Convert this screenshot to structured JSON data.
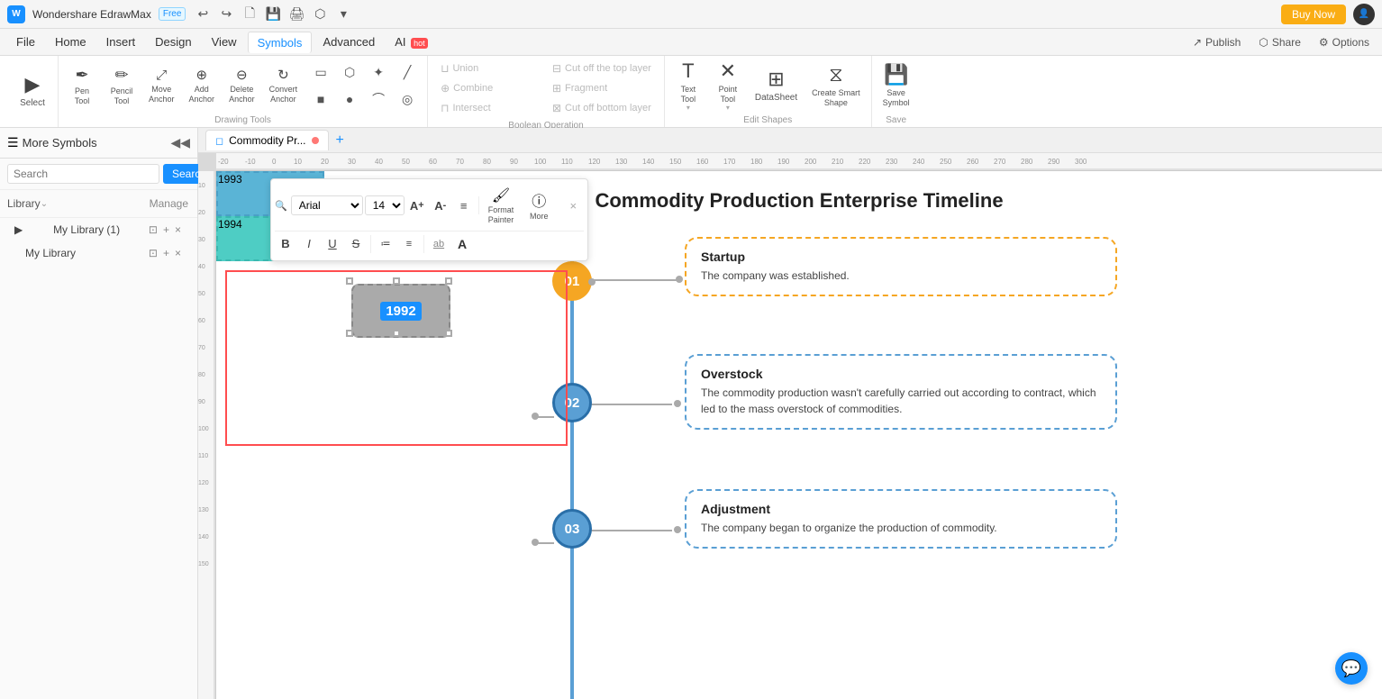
{
  "app": {
    "name": "Wondershare EdrawMax",
    "badge": "Free",
    "title_bar_icons": [
      "undo",
      "redo",
      "new",
      "save-local",
      "print",
      "export",
      "dropdown"
    ],
    "buy_now": "Buy Now"
  },
  "menu": {
    "items": [
      "File",
      "Home",
      "Insert",
      "Design",
      "View",
      "Symbols",
      "Advanced",
      "AI"
    ],
    "active": "Symbols",
    "ai_hot": "hot",
    "right": [
      "Publish",
      "Share",
      "Options"
    ]
  },
  "toolbar": {
    "select_label": "Select",
    "pen_label": "Pen\nTool",
    "pencil_label": "Pencil\nTool",
    "move_anchor_label": "Move\nAnchor",
    "add_anchor_label": "Add\nAnchor",
    "delete_anchor_label": "Delete\nAnchor",
    "convert_anchor_label": "Convert\nAnchor",
    "drawing_tools_label": "Drawing Tools",
    "union_label": "Union",
    "combine_label": "Combine",
    "cut_top_label": "Cut off the top layer",
    "fragment_label": "Fragment",
    "intersect_label": "Intersect",
    "cut_bottom_label": "Cut off bottom layer",
    "bool_ops_label": "Boolean Operation",
    "text_tool_label": "Text\nTool",
    "point_tool_label": "Point\nTool",
    "datasheet_label": "DataSheet",
    "create_smart_shape_label": "Create Smart\nShape",
    "save_symbol_label": "Save\nSymbol",
    "edit_shapes_label": "Edit Shapes",
    "save_label": "Save"
  },
  "sidebar": {
    "title": "More Symbols",
    "search_placeholder": "Search",
    "search_btn": "Search",
    "manage_label": "Manage",
    "library_label": "Library",
    "my_library_1": "My Library (1)",
    "my_library_2": "My Library"
  },
  "canvas": {
    "tab_name": "Commodity Pr...",
    "title": "Commodity Production Enterprise Timeline",
    "timeline": {
      "nodes": [
        {
          "id": "01",
          "color": "#f5a623"
        },
        {
          "id": "02",
          "color": "#5a9fd4"
        },
        {
          "id": "03",
          "color": "#5a9fd4"
        }
      ],
      "years": [
        "1992",
        "1993",
        "1994"
      ],
      "events": [
        {
          "title": "Startup",
          "text": "The company was established.",
          "border_color": "#f5a623"
        },
        {
          "title": "Overstock",
          "text": "The commodity production wasn't carefully carried out according to contract, which led to the mass overstock of commodities.",
          "border_color": "#5a9fd4"
        },
        {
          "title": "Adjustment",
          "text": "The company began to organize the production of commodity.",
          "border_color": "#5a9fd4"
        }
      ]
    }
  },
  "text_toolbar": {
    "font": "Arial",
    "size": "14",
    "increase_size": "A+",
    "decrease_size": "A-",
    "align": "≡",
    "bold": "B",
    "italic": "I",
    "underline": "U",
    "strikethrough": "S",
    "ordered_list": "OL",
    "unordered_list": "UL",
    "ab_label": "ab",
    "A_label": "A",
    "format_painter_label": "Format\nPainter",
    "more_label": "More"
  }
}
